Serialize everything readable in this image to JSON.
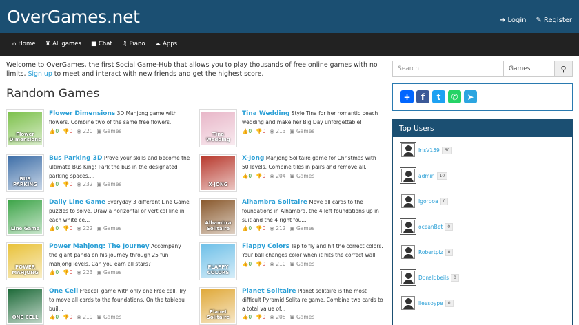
{
  "header": {
    "logo": "OverGames.net",
    "login": "Login",
    "register": "Register"
  },
  "nav": [
    {
      "label": "Home",
      "icon": "home-icon"
    },
    {
      "label": "All games",
      "icon": "gamepad-icon"
    },
    {
      "label": "Chat",
      "icon": "chat-icon"
    },
    {
      "label": "Piano",
      "icon": "music-icon"
    },
    {
      "label": "Apps",
      "icon": "apps-icon"
    }
  ],
  "welcome": {
    "text1": "Welcome to OverGames, the first Social Game-Hub that allows you to play thousands of free online games with no limits,",
    "link": "Sign up",
    "text2": "to meet and interact with new friends and get the highest score."
  },
  "random_title": "Random Games",
  "games": [
    {
      "title": "Flower Dimensions",
      "desc": "3D Mahjong game with flowers. Combine two of the same free flowers.",
      "likes": "0",
      "dislikes": "0",
      "views": "220",
      "category": "Games",
      "thumb_color": "#7cc04a",
      "thumb_label": "Flower Dimensions"
    },
    {
      "title": "Tina Wedding",
      "desc": "Style Tina for her romantic beach wedding and make her Big Day unforgettable!",
      "likes": "0",
      "dislikes": "0",
      "views": "213",
      "category": "Games",
      "thumb_color": "#e8b6c8",
      "thumb_label": "Tina Wedding"
    },
    {
      "title": "Bus Parking 3D",
      "desc": "Prove your skills and become the ultimate Bus King! Park the bus in the designated parking spaces....",
      "likes": "0",
      "dislikes": "0",
      "views": "232",
      "category": "Games",
      "thumb_color": "#3f6fa8",
      "thumb_label": "BUS PARKING"
    },
    {
      "title": "X-Jong",
      "desc": "Mahjong Solitaire game for Christmas with 50 levels. Combine tiles in pairs and remove all.",
      "likes": "0",
      "dislikes": "0",
      "views": "204",
      "category": "Games",
      "thumb_color": "#b83a2e",
      "thumb_label": "X-JONG"
    },
    {
      "title": "Daily Line Game",
      "desc": "Everyday 3 different Line Game puzzles to solve. Draw a horizontal or vertical line in each white ce...",
      "likes": "0",
      "dislikes": "0",
      "views": "222",
      "category": "Games",
      "thumb_color": "#3fa54a",
      "thumb_label": "Line Game"
    },
    {
      "title": "Alhambra Solitaire",
      "desc": "Move all cards to the foundations in Alhambra, the 4 left foundations up in suit and the 4 right fou...",
      "likes": "0",
      "dislikes": "0",
      "views": "212",
      "category": "Games",
      "thumb_color": "#8a5a2e",
      "thumb_label": "Alhambra Solitaire"
    },
    {
      "title": "Power Mahjong: The Journey",
      "desc": "Accompany the giant panda on his journey through 25 fun mahjong levels. Can you earn all stars?",
      "likes": "0",
      "dislikes": "0",
      "views": "223",
      "category": "Games",
      "thumb_color": "#e9c23a",
      "thumb_label": "POWER MAHJONG"
    },
    {
      "title": "Flappy Colors",
      "desc": "Tap to fly and hit the correct colors. Your ball changes color when it hits the correct wall.",
      "likes": "0",
      "dislikes": "0",
      "views": "210",
      "category": "Games",
      "thumb_color": "#6fc0e8",
      "thumb_label": "FLAPPY COLORS"
    },
    {
      "title": "One Cell",
      "desc": "Freecell game with only one Free cell. Try to move all cards to the foundations. On the tableau buil...",
      "likes": "0",
      "dislikes": "0",
      "views": "219",
      "category": "Games",
      "thumb_color": "#1f6b3a",
      "thumb_label": "ONE CELL"
    },
    {
      "title": "Planet Solitaire",
      "desc": "Planet solitaire is the most difficult Pyramid Solitaire game. Combine two cards to a total value of...",
      "likes": "0",
      "dislikes": "0",
      "views": "208",
      "category": "Games",
      "thumb_color": "#e0a93a",
      "thumb_label": "Planet Solitaire"
    }
  ],
  "search": {
    "placeholder": "Search",
    "category": "Games"
  },
  "top_users": {
    "title": "Top Users",
    "users": [
      {
        "name": "IrisV159",
        "score": "60"
      },
      {
        "name": "admin",
        "score": "10"
      },
      {
        "name": "Igorpoa",
        "score": "0"
      },
      {
        "name": "oceanBet",
        "score": "0"
      },
      {
        "name": "Robertpiz",
        "score": "0"
      },
      {
        "name": "Donaldbeils",
        "score": "0"
      },
      {
        "name": "lleesoype",
        "score": "0"
      }
    ]
  },
  "colors": {
    "header": "#1b4f72",
    "nav": "#222222",
    "link": "#2a9fd6"
  }
}
